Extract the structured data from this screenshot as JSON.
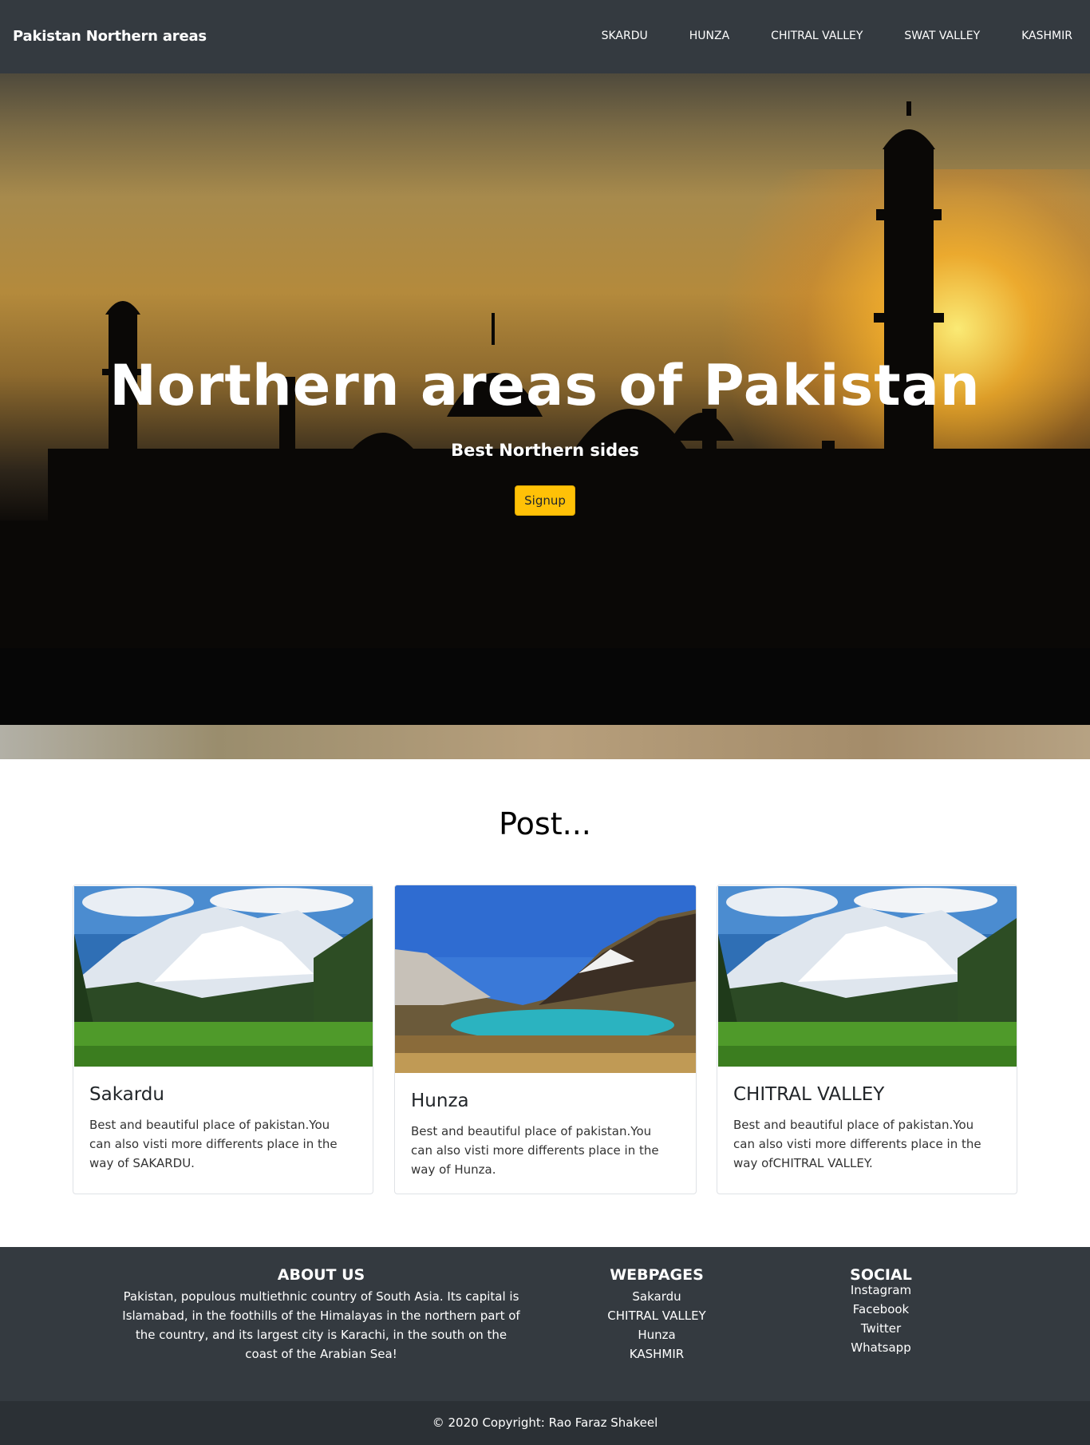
{
  "navbar": {
    "brand": "Pakistan Northern areas",
    "links": [
      "SKARDU",
      "HUNZA",
      "CHITRAL VALLEY",
      "SWAT VALLEY",
      "KASHMIR"
    ]
  },
  "hero": {
    "title": "Northern areas of Pakistan",
    "subtitle": "Best Northern sides",
    "button_label": "Signup"
  },
  "posts": {
    "heading": "Post...",
    "cards": [
      {
        "title": "Sakardu",
        "text": "Best and beautiful place of pakistan.You can also visti more differents place in the way of SAKARDU."
      },
      {
        "title": "Hunza",
        "text": "Best and beautiful place of pakistan.You can also visti more differents place in the way of Hunza."
      },
      {
        "title": "CHITRAL VALLEY",
        "text": "Best and beautiful place of pakistan.You can also visti more differents place in the way ofCHITRAL VALLEY."
      }
    ]
  },
  "footer": {
    "about": {
      "heading": "ABOUT US",
      "text": "Pakistan, populous multiethnic country of South Asia. Its capital is Islamabad, in the foothills of the Himalayas in the northern part of the country, and its largest city is Karachi, in the south on the coast of the Arabian Sea!"
    },
    "webpages": {
      "heading": "WEBPAGES",
      "links": [
        "Sakardu",
        "CHITRAL VALLEY",
        "Hunza",
        "KASHMIR"
      ]
    },
    "social": {
      "heading": "SOCIAL",
      "links": [
        "Instagram",
        "Facebook",
        "Twitter",
        "Whatsapp"
      ]
    },
    "copyright": "© 2020 Copyright: Rao Faraz Shakeel"
  },
  "colors": {
    "navbar_bg": "#343a40",
    "accent_button": "#ffc107",
    "footer_bg": "#343a40"
  }
}
